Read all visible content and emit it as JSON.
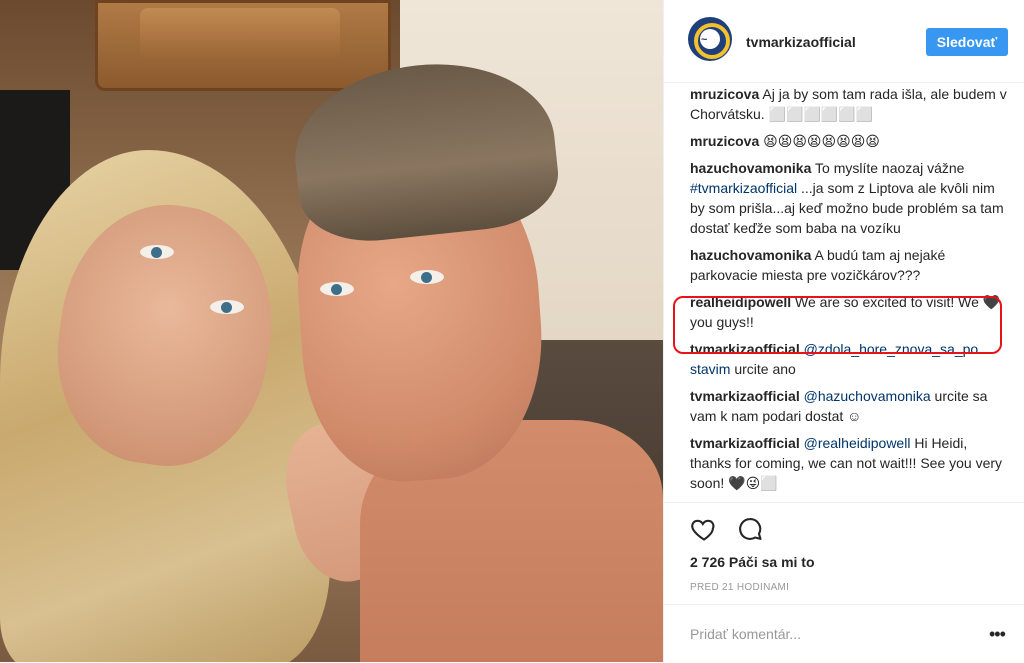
{
  "post": {
    "username": "tvmarkizaofficial",
    "follow_label": "Sledovať",
    "photo_alt": "selfie"
  },
  "comments": [
    {
      "user": "mruzicova",
      "pre": "",
      "link": "",
      "text": "Aj ja by som tam rada išla, ale budem v Chorvátsku. ⬜⬜⬜⬜⬜⬜"
    },
    {
      "user": "mruzicova",
      "pre": "",
      "link": "",
      "text": "😫😫😫😫😫😫😫😫"
    },
    {
      "user": "hazuchovamonika",
      "pre": "To myslíte naozaj vážne ",
      "link": "#tvmarkizaofficial",
      "text": " ...ja som z Liptova ale kvôli nim by som prišla...aj keď možno bude problém sa tam dostať keďže som baba na vozíku"
    },
    {
      "user": "hazuchovamonika",
      "pre": "",
      "link": "",
      "text": "A budú tam aj nejaké parkovacie miesta pre vozičkárov???"
    },
    {
      "user": "realheidipowell",
      "pre": "",
      "link": "",
      "text": "We are so excited to visit! We 🖤 you guys!!"
    },
    {
      "user": "tvmarkizaofficial",
      "pre": "",
      "link": "@zdola_hore_znova_sa_po stavim",
      "text": " urcite ano"
    },
    {
      "user": "tvmarkizaofficial",
      "pre": "",
      "link": "@hazuchovamonika",
      "text": " urcite sa vam k nam podari dostat ☺"
    },
    {
      "user": "tvmarkizaofficial",
      "pre": "",
      "link": "@realheidipowell",
      "text": " Hi Heidi, thanks for coming, we can not wait!!! See you very soon! 🖤😜⬜"
    }
  ],
  "likes": "2 726 Páči sa mi to",
  "time": "PRED 21 HODINAMI",
  "add_comment": {
    "placeholder": "Pridať komentár..."
  },
  "icons": {
    "like": "heart-icon",
    "comment": "comment-icon",
    "more": "more-options-icon"
  },
  "colors": {
    "follow": "#3897f0",
    "highlight": "#e8131a",
    "link": "#003569"
  }
}
